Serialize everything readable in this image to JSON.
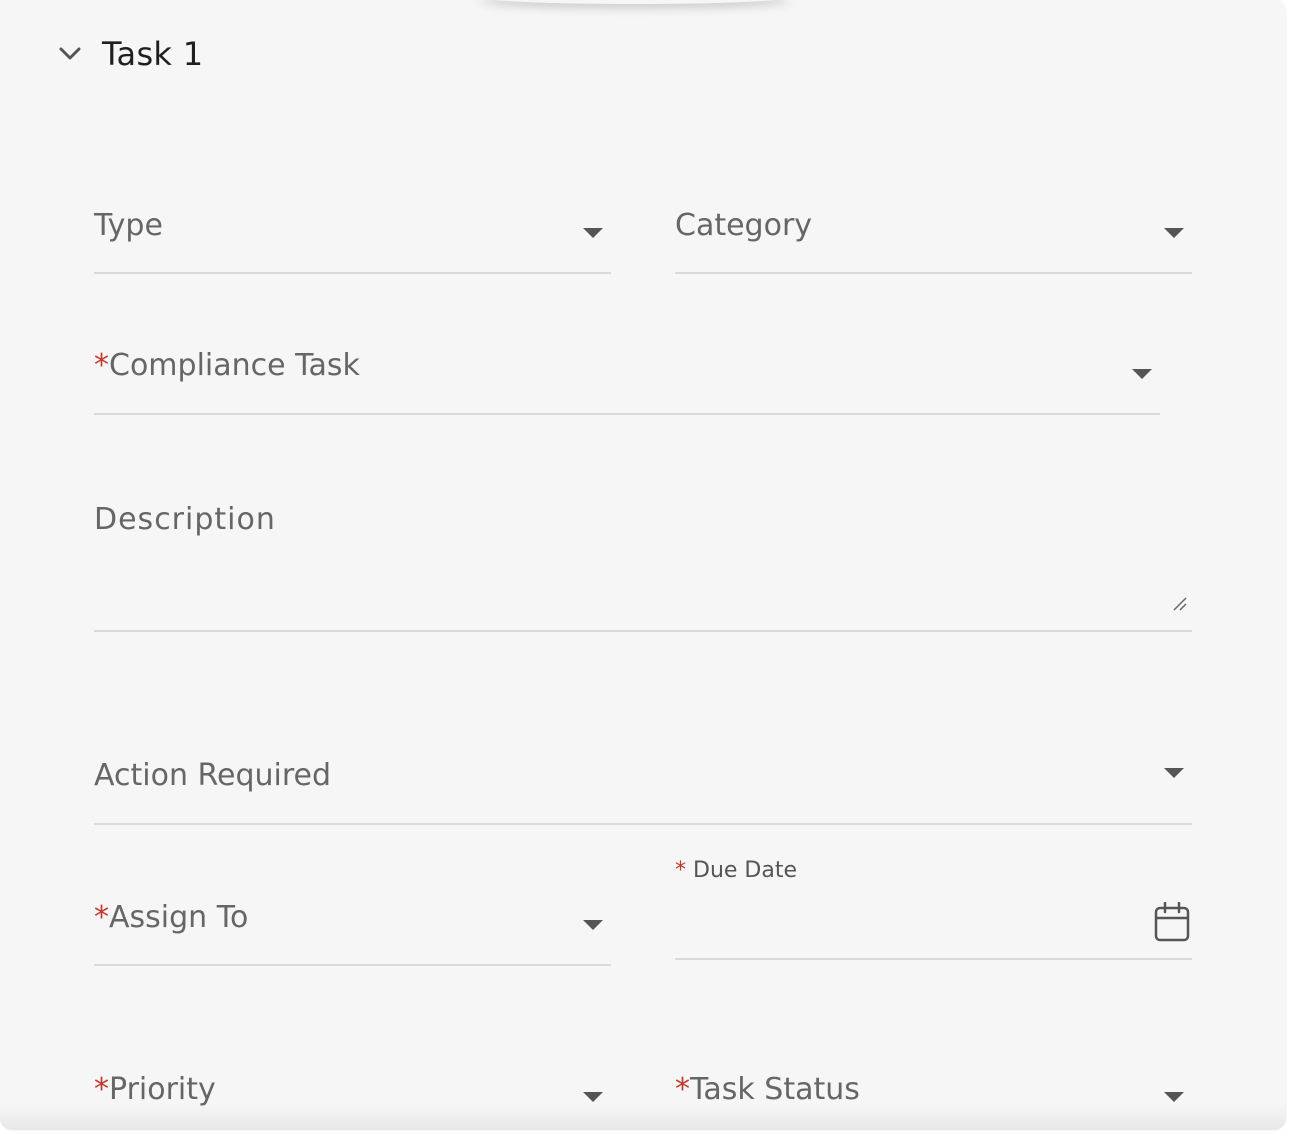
{
  "section": {
    "title": "Task 1",
    "expanded": true
  },
  "fields": {
    "type": {
      "label": "Type",
      "required": false
    },
    "category": {
      "label": "Category",
      "required": false
    },
    "compliance_task": {
      "label": "Compliance Task",
      "required": true
    },
    "description": {
      "label": "Description",
      "required": false
    },
    "action_required": {
      "label": "Action Required",
      "required": false
    },
    "assign_to": {
      "label": "Assign To",
      "required": true
    },
    "due_date": {
      "label": "Due Date",
      "required": true
    },
    "priority": {
      "label": "Priority",
      "required": true
    },
    "task_status": {
      "label": "Task Status",
      "required": true
    }
  },
  "required_marker": "*",
  "colors": {
    "background": "#f6f6f6",
    "label": "#666666",
    "required": "#c0392b",
    "underline": "#d9d9d9",
    "icon": "#555555"
  },
  "icons": {
    "toggle": "chevron-down-icon",
    "dropdown": "caret-down-icon",
    "resize": "resize-handle-icon",
    "calendar": "calendar-icon"
  }
}
